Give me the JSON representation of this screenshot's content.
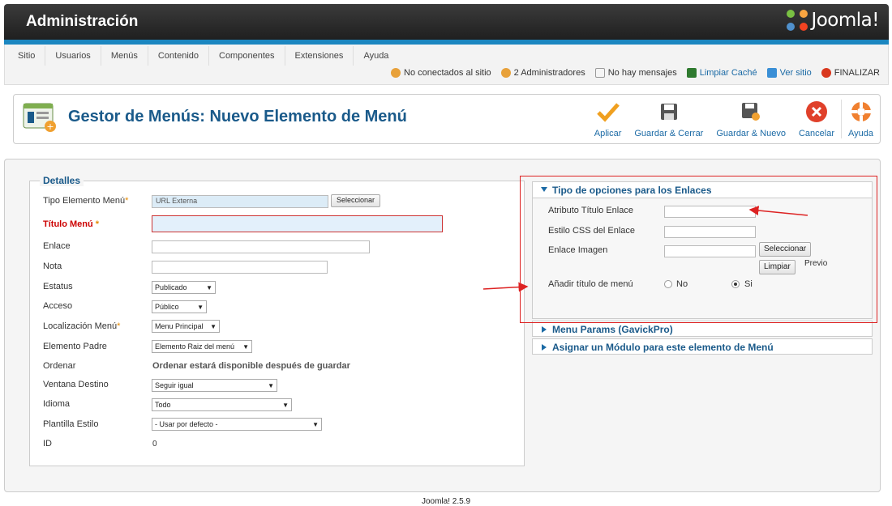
{
  "header": {
    "title": "Administración",
    "logo_text": "Joomla!"
  },
  "menubar": {
    "items": [
      "Sitio",
      "Usuarios",
      "Menús",
      "Contenido",
      "Componentes",
      "Extensiones",
      "Ayuda"
    ]
  },
  "status": {
    "not_connected": "No conectados al sitio",
    "admins": "2 Administradores",
    "messages": "No hay mensajes",
    "clear_cache": "Limpiar Caché",
    "view_site": "Ver sitio",
    "logout": "FINALIZAR"
  },
  "toolbar": {
    "title": "Gestor de Menús: Nuevo Elemento de Menú",
    "apply": "Aplicar",
    "save_close": "Guardar & Cerrar",
    "save_new": "Guardar & Nuevo",
    "cancel": "Cancelar",
    "help": "Ayuda"
  },
  "details": {
    "legend": "Detalles",
    "type_label": "Tipo Elemento Menú",
    "type_value": "URL Externa",
    "select_button": "Seleccionar",
    "title_label": "Título Menú",
    "title_value": "",
    "link_label": "Enlace",
    "link_value": "",
    "note_label": "Nota",
    "note_value": "",
    "status_label": "Estatus",
    "status_value": "Publicado",
    "access_label": "Acceso",
    "access_value": "Público",
    "location_label": "Localización Menú",
    "location_value": "Menu Principal",
    "parent_label": "Elemento Padre",
    "parent_value": "Elemento Raiz del menú",
    "order_label": "Ordenar",
    "order_value": "Ordenar estará disponible después de guardar",
    "target_label": "Ventana Destino",
    "target_value": "Seguir igual",
    "language_label": "Idioma",
    "language_value": "Todo",
    "template_label": "Plantilla Estilo",
    "template_value": "- Usar por defecto -",
    "id_label": "ID",
    "id_value": "0",
    "required_mark": "*"
  },
  "link_options": {
    "heading": "Tipo de opciones para los Enlaces",
    "title_attr_label": "Atributo Título Enlace",
    "css_label": "Estilo CSS del Enlace",
    "image_label": "Enlace Imagen",
    "select_button": "Seleccionar",
    "clear_button": "Limpiar",
    "preview": "Previo",
    "add_title_label": "Añadir título de menú",
    "no": "No",
    "yes": "Si",
    "add_title_selected": "Si"
  },
  "accordions": {
    "menu_params": "Menu Params (GavickPro)",
    "assign_module": "Asignar un Módulo para este elemento de Menú"
  },
  "footer": {
    "version": "Joomla! 2.5.9"
  },
  "colors": {
    "accent": "#1a5a8a",
    "header_bar": "#1b86c0",
    "annotation": "#d22222"
  }
}
